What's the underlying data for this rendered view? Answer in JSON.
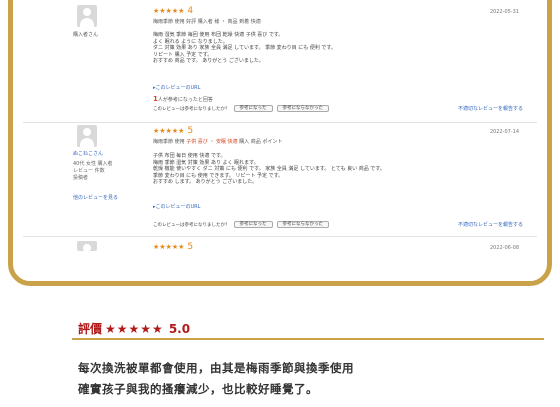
{
  "reviews": [
    {
      "user_name": "購入者さん",
      "rating_stars": "★★★★★",
      "rating_num": "4",
      "date": "2022-05-31",
      "subline": "梅雨季節 使用 好評 購入者 様 ・ 商品 到着 快適",
      "body": [
        "梅雨 湿気 季節 毎回 使用 布団 乾燥 快適 子供 喜び です。",
        "よく 眠れる ように なりました。",
        "ダニ 対策 効果 あり 家族 全員 満足 しています。 季節 変わり目 にも 便利 です。",
        "リピート 購入 予定 です。",
        "おすすめ 商品 です。 ありがとう ございました。"
      ],
      "more": "▸このレビューのURL",
      "helpful_count": "1",
      "helpful_text": "人が参考になったと回答",
      "vote_prompt": "このレビューは参考になりましたか？",
      "vote_yes": "参考になった",
      "vote_no": "参考にならなかった",
      "report": "不適切なレビューを報告する"
    },
    {
      "user_name": "ぬこねこさん",
      "user_meta": [
        "40代 女性 購入者",
        "レビュー 件数",
        "投稿者"
      ],
      "user_link": "他のレビューを見る",
      "rating_stars": "★★★★★",
      "rating_num": "5",
      "date": "2022-07-14",
      "subline_prefix": "梅雨季節 使用 ",
      "subline_highlight": "子供 喜び ・ 安眠 快適",
      "subline_suffix": " 購入 商品 ポイント",
      "body": [
        "子供 布団 毎日 使用 快適 です。",
        "梅雨 季節 湿気 対策 効果 あり よく 眠れます。",
        "乾燥 機能 使いやすく ダニ 対策 にも 便利 です。 家族 全員 満足 しています。 とても 良い 商品 です。",
        "季節 変わり目 にも 使用 できます。 リピート 予定 です。",
        "おすすめ します。 ありがとう ございました。"
      ],
      "more": "▸このレビューのURL",
      "vote_prompt": "このレビューは参考になりましたか？",
      "vote_yes": "参考になった",
      "vote_no": "参考にならなかった",
      "report": "不適切なレビューを報告する"
    },
    {
      "rating_stars": "★★★★★",
      "rating_num": "5",
      "date": "2022-06-08"
    }
  ],
  "summary": {
    "label": "評價",
    "stars": "★★★★★",
    "score": "5.0",
    "line1": "每次換洗被單都會使用，由其是梅雨季節與換季使用",
    "line2": "確實孩子與我的搔癢減少，也比較好睡覺了。"
  },
  "colors": {
    "frame": "#c9a24a",
    "star": "#e8891c",
    "summary_red": "#b21a1a"
  }
}
